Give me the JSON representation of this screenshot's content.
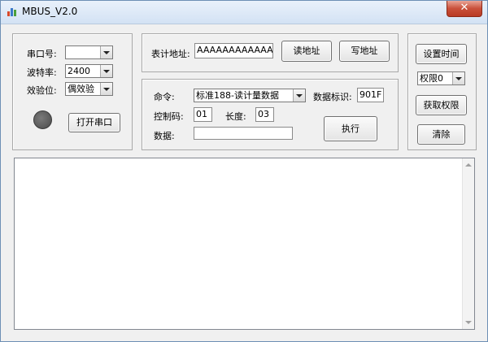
{
  "window": {
    "title": "MBUS_V2.0",
    "close_label": "✕"
  },
  "serial": {
    "port_label": "串口号:",
    "port_value": "",
    "baud_label": "波特率:",
    "baud_value": "2400",
    "parity_label": "效验位:",
    "parity_value": "偶效验",
    "open_button": "打开串口"
  },
  "meter": {
    "address_label": "表计地址:",
    "address_value": "AAAAAAAAAAAAAA",
    "read_button": "读地址",
    "write_button": "写地址"
  },
  "command": {
    "cmd_label": "命令:",
    "cmd_value": "标准188-读计量数据",
    "data_id_label": "数据标识:",
    "data_id_value": "901F",
    "control_label": "控制码:",
    "control_value": "01",
    "length_label": "长度:",
    "length_value": "03",
    "data_label": "数据:",
    "data_value": "",
    "execute_button": "执行"
  },
  "side": {
    "set_time_button": "设置时间",
    "permission_value": "权限0",
    "get_permission_button": "获取权限",
    "clear_button": "清除"
  },
  "output": {
    "text": ""
  },
  "colors": {
    "led": "#5a5a5a",
    "title_bar": "#d3e2f4",
    "close": "#c9503a"
  }
}
